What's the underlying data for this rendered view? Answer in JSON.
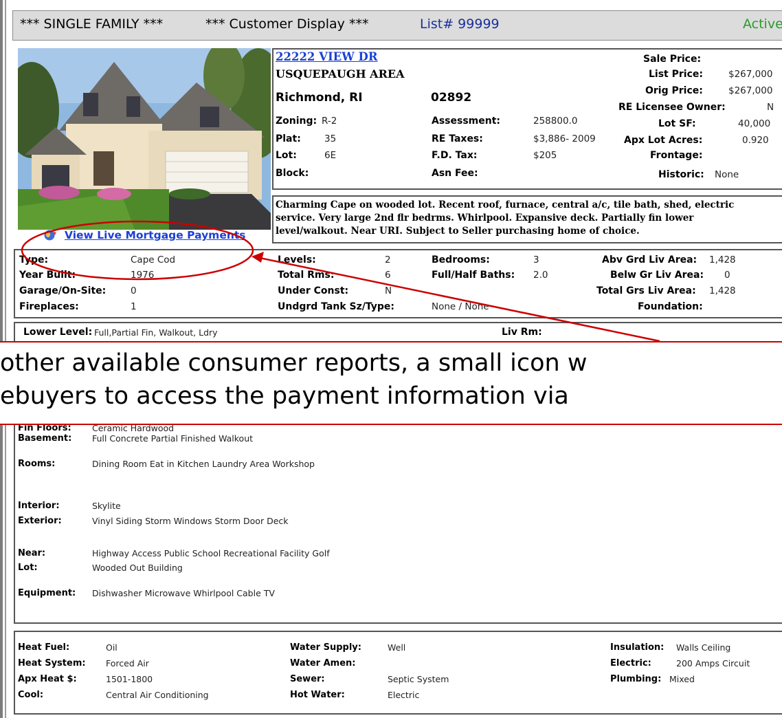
{
  "header": {
    "type": "*** SINGLE FAMILY ***",
    "display": "*** Customer Display ***",
    "list": "List# 99999",
    "status": "Active"
  },
  "address": {
    "street": "22222 VIEW DR",
    "area": "USQUEPAUGH AREA",
    "city": "Richmond, RI",
    "zip": "02892"
  },
  "zoning": {
    "l": "Zoning:",
    "v": "R-2"
  },
  "plat": {
    "l": "Plat:",
    "v": "35"
  },
  "lot": {
    "l": "Lot:",
    "v": "6E"
  },
  "block": {
    "l": "Block:"
  },
  "assessment": {
    "l": "Assessment:",
    "v": "258800.0"
  },
  "re_taxes": {
    "l": "RE Taxes:",
    "v": "$3,886- 2009"
  },
  "fd_tax": {
    "l": "F.D. Tax:",
    "v": "$205"
  },
  "asn_fee": {
    "l": "Asn Fee:"
  },
  "sale_price": {
    "l": "Sale Price:"
  },
  "list_price": {
    "l": "List Price:",
    "v": "$267,000"
  },
  "orig_price": {
    "l": "Orig Price:",
    "v": "$267,000"
  },
  "re_owner": {
    "l": "RE Licensee Owner:",
    "v": "N"
  },
  "lot_sf": {
    "l": "Lot SF:",
    "v": "40,000"
  },
  "acres": {
    "l": "Apx Lot Acres:",
    "v": "0.920"
  },
  "frontage": {
    "l": "Frontage:"
  },
  "historic": {
    "l": "Historic:",
    "v": "None"
  },
  "remarks": [
    "Charming Cape on wooded lot. Recent roof, furnace, central a/c, tile bath, shed, electric",
    "service. Very large 2nd flr bedrms. Whirlpool. Expansive deck. Partially fin lower",
    "level/walkout. Near URI. Subject to Seller purchasing home of choice."
  ],
  "mortgage_link": "View Live Mortgage Payments",
  "details": {
    "type": {
      "l": "Type:",
      "v": "Cape Cod"
    },
    "year_built": {
      "l": "Year Built:",
      "v": "1976"
    },
    "garage": {
      "l": "Garage/On-Site:",
      "v": "0"
    },
    "fireplaces": {
      "l": "Fireplaces:",
      "v": "1"
    },
    "levels": {
      "l": "Levels:",
      "v": "2"
    },
    "total_rms": {
      "l": "Total Rms:",
      "v": "6"
    },
    "under_const": {
      "l": "Under Const:",
      "v": "N"
    },
    "tank": {
      "l": "Undgrd Tank Sz/Type:",
      "v": "None / None"
    },
    "bedrooms": {
      "l": "Bedrooms:",
      "v": "3"
    },
    "baths": {
      "l": "Full/Half Baths:",
      "v": "2.0"
    },
    "abv_grd": {
      "l": "Abv Grd Liv Area:",
      "v": "1,428"
    },
    "belw_gr": {
      "l": "Belw Gr Liv Area:",
      "v": "0"
    },
    "total_grs": {
      "l": "Total Grs Liv Area:",
      "v": "1,428"
    },
    "foundation": {
      "l": "Foundation:"
    }
  },
  "rooms": {
    "lower_level": {
      "l": "Lower Level:",
      "v": "Full,Partial Fin, Walkout, Ldry"
    },
    "liv_rm": {
      "l": "Liv Rm:"
    }
  },
  "banner": {
    "line1": "other available consumer reports, a small icon w",
    "line2": "ebuyers to access the payment information via"
  },
  "features": {
    "fin_floors": {
      "l": "Fin Floors:",
      "v": "Ceramic  Hardwood"
    },
    "basement": {
      "l": "Basement:",
      "v": "Full  Concrete  Partial Finished  Walkout"
    },
    "rooms": {
      "l": "Rooms:",
      "v": "Dining Room  Eat in Kitchen  Laundry Area  Workshop"
    },
    "interior": {
      "l": "Interior:",
      "v": "Skylite"
    },
    "exterior": {
      "l": "Exterior:",
      "v": "Vinyl Siding  Storm Windows  Storm Door  Deck"
    },
    "near": {
      "l": "Near:",
      "v": "Highway Access  Public School  Recreational Facility  Golf"
    },
    "lot": {
      "l": "Lot:",
      "v": "Wooded  Out Building"
    },
    "equipment": {
      "l": "Equipment:",
      "v": "Dishwasher  Microwave  Whirlpool  Cable TV"
    }
  },
  "utilities": {
    "heat_fuel": {
      "l": "Heat Fuel:",
      "v": "Oil"
    },
    "heat_system": {
      "l": "Heat System:",
      "v": "Forced Air"
    },
    "heat_cost": {
      "l": "Apx Heat $:",
      "v": "1501-1800"
    },
    "cool": {
      "l": "Cool:",
      "v": "Central Air Conditioning"
    },
    "water_supply": {
      "l": "Water Supply:",
      "v": "Well"
    },
    "water_amen": {
      "l": "Water Amen:"
    },
    "sewer": {
      "l": "Sewer:",
      "v": "Septic System"
    },
    "hot_water": {
      "l": "Hot Water:",
      "v": "Electric"
    },
    "insulation": {
      "l": "Insulation:",
      "v": "Walls  Ceiling"
    },
    "electric": {
      "l": "Electric:",
      "v": "200 Amps  Circuit"
    },
    "plumbing": {
      "l": "Plumbing:",
      "v": "Mixed"
    }
  },
  "colors": {
    "link": "#1b3fd6",
    "active": "#2a9a2a",
    "annotation": "#cc0000",
    "header_bg": "#dcdcdc"
  }
}
